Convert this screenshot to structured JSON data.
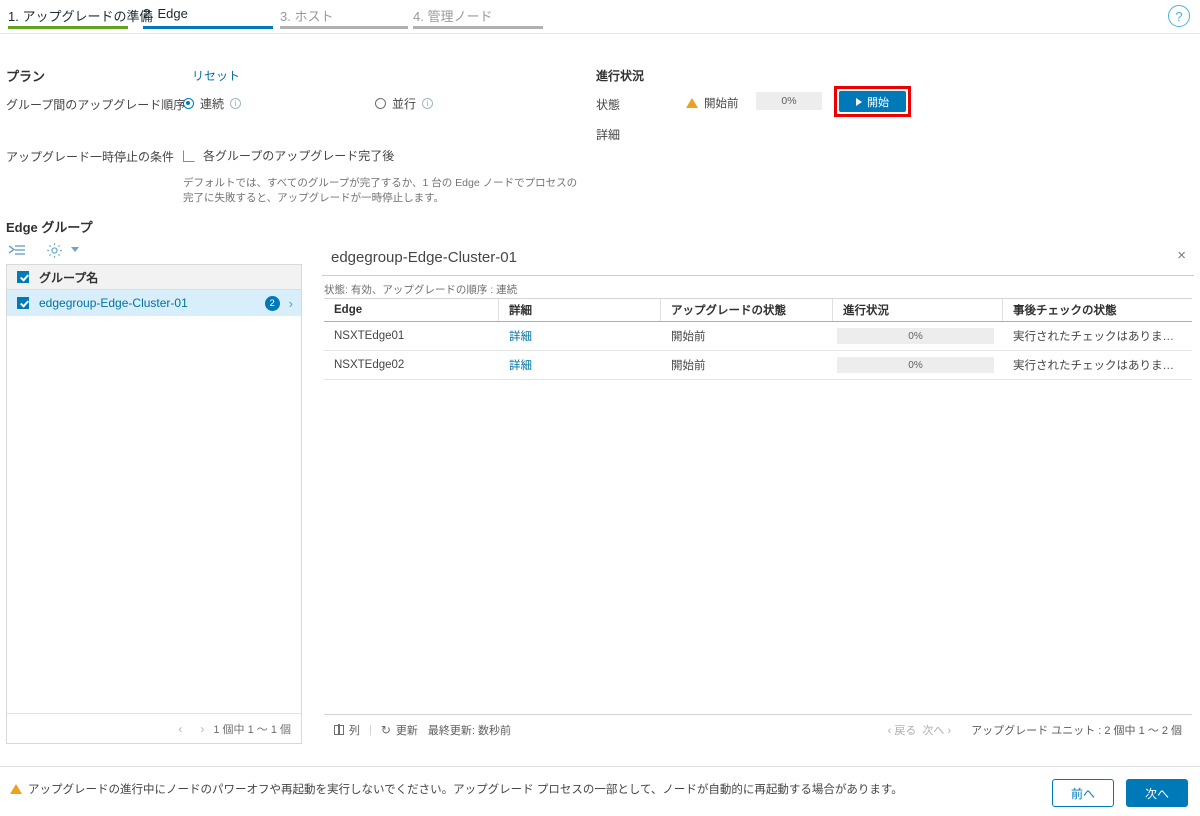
{
  "wizard": {
    "tabs": [
      {
        "label": "1. アップグレードの準備",
        "state": "done"
      },
      {
        "label": "2. Edge",
        "state": "active"
      },
      {
        "label": "3. ホスト",
        "state": "future"
      },
      {
        "label": "4. 管理ノード",
        "state": "future"
      }
    ],
    "help_icon": "?"
  },
  "plan": {
    "title": "プラン",
    "reset_label": "リセット",
    "order_label": "グループ間のアップグレード順序",
    "order_options": [
      {
        "label": "連続",
        "selected": true
      },
      {
        "label": "並行",
        "selected": false
      }
    ],
    "pause_label": "アップグレード一時停止の条件",
    "pause_checkbox_label": "各グループのアップグレード完了後",
    "pause_checked": false,
    "pause_description": "デフォルトでは、すべてのグループが完了するか、1 台の Edge ノードでプロセスの完了に失敗すると、アップグレードが一時停止します。"
  },
  "progress": {
    "title": "進行状況",
    "state_label": "状態",
    "state_value": "開始前",
    "percent": "0%",
    "detail_label": "詳細",
    "start_button": "開始"
  },
  "edge_groups": {
    "title": "Edge グループ",
    "column_header": "グループ名",
    "header_checked": true,
    "rows": [
      {
        "name": "edgegroup-Edge-Cluster-01",
        "badge": "2",
        "checked": true,
        "selected": true
      }
    ],
    "pagination": "1 個中 1 ～ 1 個",
    "prev_arrow": "‹",
    "next_arrow": "›"
  },
  "detail": {
    "title": "edgegroup-Edge-Cluster-01",
    "close_label": "×",
    "subtitle": "状態: 有効、アップグレードの順序 :  連続",
    "columns": [
      "Edge",
      "詳細",
      "アップグレードの状態",
      "進行状況",
      "事後チェックの状態"
    ],
    "rows": [
      {
        "edge": "NSXTEdge01",
        "detail_link": "詳細",
        "upgrade_state": "開始前",
        "percent": "0%",
        "postcheck": "実行されたチェックはありま…"
      },
      {
        "edge": "NSXTEdge02",
        "detail_link": "詳細",
        "upgrade_state": "開始前",
        "percent": "0%",
        "postcheck": "実行されたチェックはありま…"
      }
    ],
    "footer": {
      "columns_label": "列",
      "refresh_label": "更新",
      "last_updated": "最終更新: 数秒前",
      "prev_label": "‹ 戻る",
      "next_label": "次へ ›",
      "count_label": "アップグレード ユニット : 2 個中 1 ～ 2 個"
    }
  },
  "footer": {
    "warning": "アップグレードの進行中にノードのパワーオフや再起動を実行しないでください。アップグレード プロセスの一部として、ノードが自動的に再起動する場合があります。",
    "previous_button": "前へ",
    "next_button": "次へ"
  },
  "colors": {
    "accent": "#0079b8",
    "link": "#0072a3",
    "done_bar": "#62a420",
    "warning": "#efa01e",
    "highlight": "#ee0000"
  }
}
